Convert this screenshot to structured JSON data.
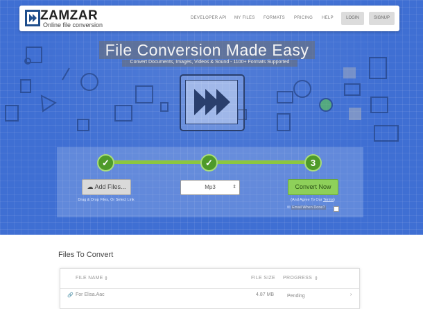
{
  "app": {
    "logo_text": "ZAMZAR",
    "tagline": "Online file conversion"
  },
  "nav": {
    "links": [
      "DEVELOPER API",
      "MY FILES",
      "FORMATS",
      "PRICING",
      "HELP"
    ],
    "login_label": "LOGIN",
    "signup_label": "SIGNUP"
  },
  "hero": {
    "title": "File Conversion Made Easy",
    "subtitle": "Convert Documents, Images, Videos & Sound - 1100+ Formats Supported"
  },
  "steps": {
    "labels": [
      "✓",
      "✓",
      "3"
    ]
  },
  "converter": {
    "add_files_label": "Add Files...",
    "add_files_hint": "Drag & Drop Files, Or Select Link",
    "format_value": "Mp3",
    "convert_label": "Convert Now",
    "agree_text": "(And Agree To Our ",
    "terms_link": "Terms",
    "agree_close": ")",
    "email_label": "Email When Done?"
  },
  "files": {
    "section_title": "Files To Convert",
    "columns": [
      "FILE NAME",
      "FILE SIZE",
      "PROGRESS"
    ],
    "rows": [
      {
        "name": "For Elisa.Aac",
        "size": "4.87 MB",
        "progress": "Pending"
      }
    ]
  },
  "colors": {
    "hero_bg": "#3f6fd3",
    "step_green": "#4e9a2a",
    "track_green": "#8cc63f",
    "convert_green": "#8ed05a"
  }
}
